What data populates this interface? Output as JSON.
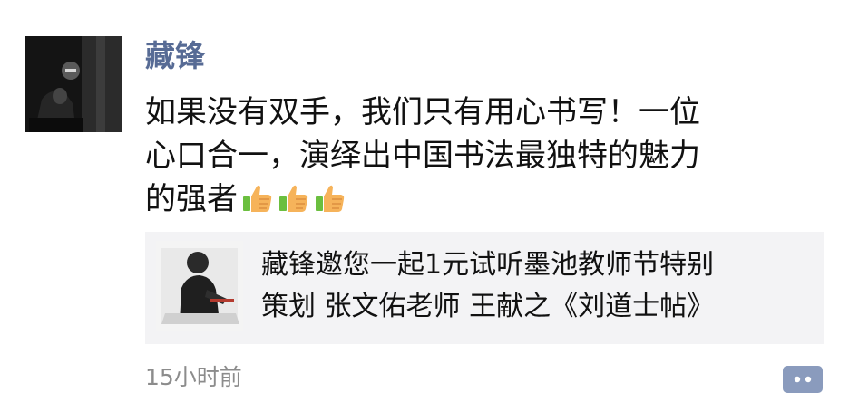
{
  "post": {
    "author": "藏锋",
    "text_lines": [
      "如果没有双手，我们只有用心书写！一位",
      "心口合一，演绎出中国书法最独特的魅力",
      "的强者"
    ],
    "emoji": [
      "thumbs-up",
      "thumbs-up",
      "thumbs-up"
    ],
    "share": {
      "title_lines": [
        "藏锋邀您一起1元试听墨池教师节特别",
        "策划 张文佑老师 王献之《刘道士帖》"
      ]
    },
    "timestamp": "15小时前",
    "icons": {
      "comment": "comment-more-icon"
    }
  },
  "colors": {
    "author_name": "#576b95",
    "text": "#111111",
    "share_background": "#f3f3f5",
    "timestamp": "#8c8c8c",
    "comment_button": "#8a9bbd"
  }
}
